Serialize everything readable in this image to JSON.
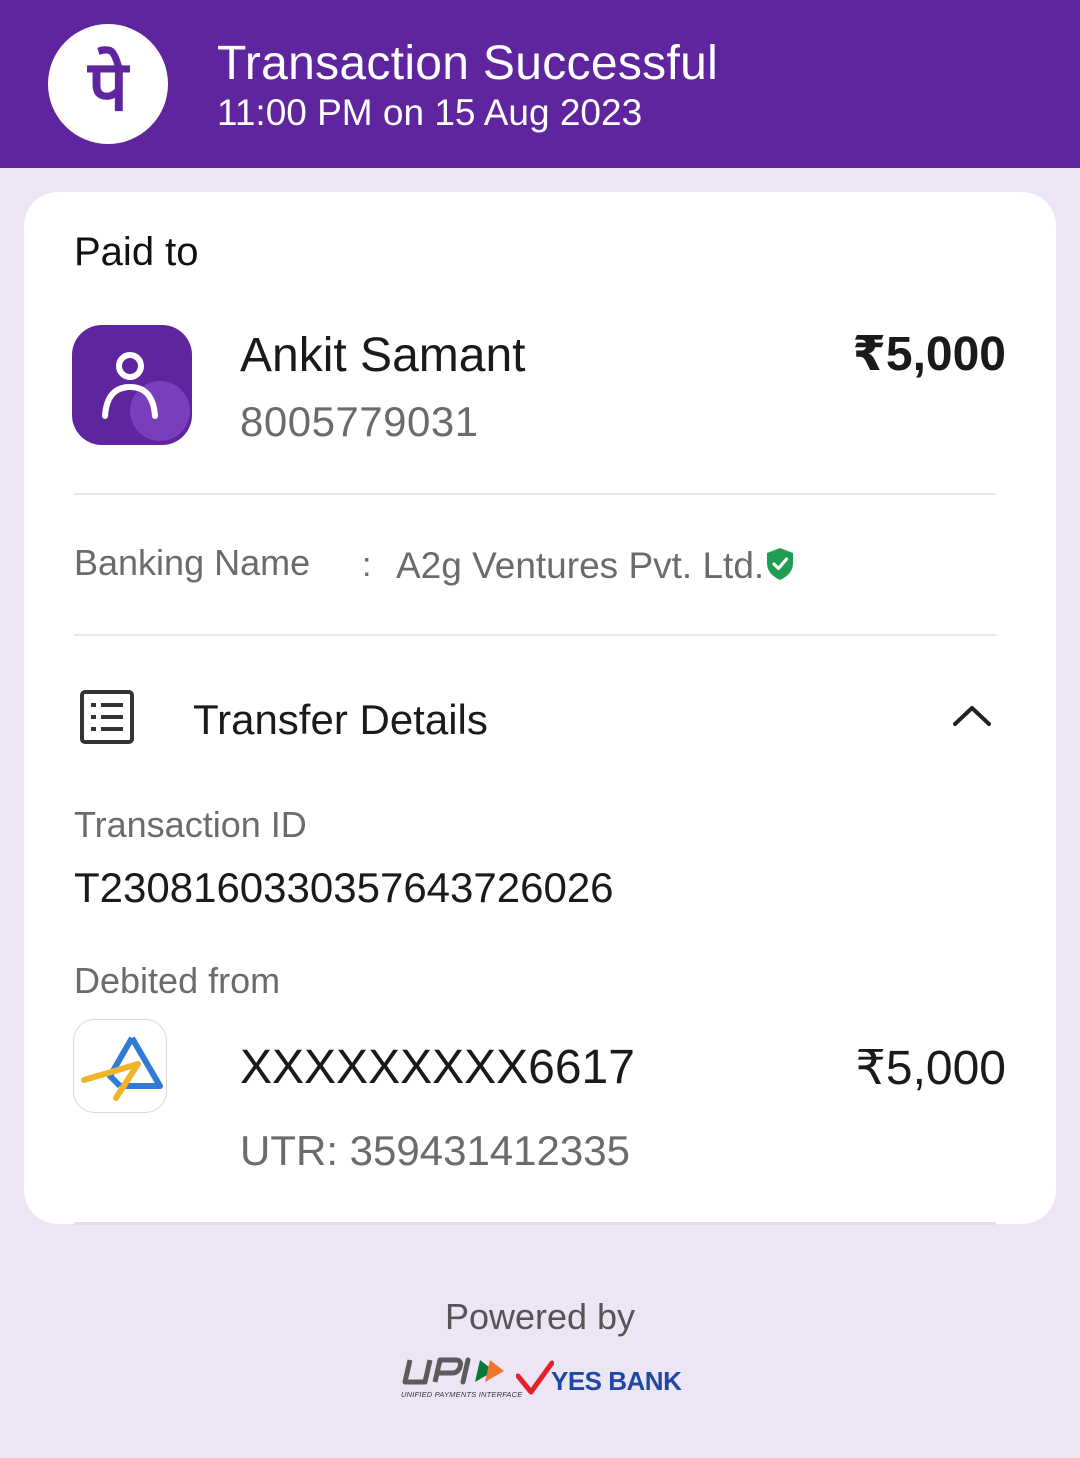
{
  "header": {
    "title": "Transaction Successful",
    "datetime": "11:00 PM on 15 Aug 2023",
    "brand_glyph": "पे",
    "background": "#5f259f"
  },
  "paid_to": {
    "label": "Paid to",
    "name": "Ankit Samant",
    "phone": "8005779031",
    "amount": "₹5,000",
    "avatar_icon": "user-icon"
  },
  "banking": {
    "label": "Banking Name",
    "separator": ":",
    "value": "A2g Ventures Pvt. Ltd.",
    "verified_icon": "shield-check-icon",
    "verified_color": "#1f9d55"
  },
  "transfer": {
    "title": "Transfer Details",
    "icon": "list-icon",
    "toggle_icon": "chevron-up-icon",
    "transaction_id_label": "Transaction ID",
    "transaction_id": "T2308160330357643726026",
    "debited_from_label": "Debited from",
    "account_number": "XXXXXXXXX6617",
    "amount": "₹5,000",
    "utr": "UTR: 359431412335",
    "bank_icon": "sbi-logo-icon"
  },
  "footer": {
    "powered_by": "Powered by",
    "upi_caption": "UNIFIED PAYMENTS INTERFACE",
    "partner_bank": "YES BANK"
  }
}
